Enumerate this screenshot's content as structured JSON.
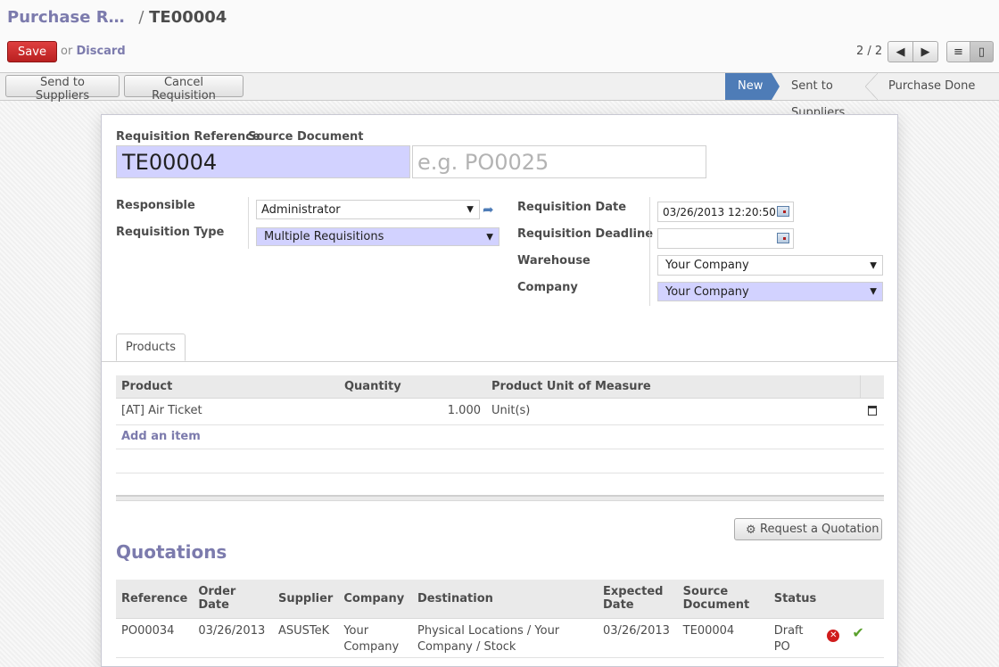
{
  "header": {
    "breadcrumb_parent": "Purchase R…",
    "breadcrumb_separator": "/",
    "breadcrumb_current": "TE00004",
    "save_label": "Save",
    "or_label": "or",
    "discard_label": "Discard",
    "pager_value": "2 / 2"
  },
  "statusbar": {
    "buttons": [
      "Send to Suppliers",
      "Cancel Requisition"
    ],
    "stages": [
      "New",
      "Sent to Suppliers",
      "Purchase Done"
    ],
    "active_stage": "New"
  },
  "form": {
    "requisition_reference_label": "Requisition Reference",
    "requisition_reference_value": "TE00004",
    "source_document_label": "Source Document",
    "source_document_placeholder": "e.g. PO0025",
    "responsible_label": "Responsible",
    "responsible_value": "Administrator",
    "requisition_type_label": "Requisition Type",
    "requisition_type_value": "Multiple Requisitions",
    "requisition_date_label": "Requisition Date",
    "requisition_date_value": "03/26/2013 12:20:50",
    "requisition_deadline_label": "Requisition Deadline",
    "requisition_deadline_value": "",
    "warehouse_label": "Warehouse",
    "warehouse_value": "Your Company",
    "company_label": "Company",
    "company_value": "Your Company"
  },
  "tabs": [
    "Products"
  ],
  "products": {
    "columns": [
      "Product",
      "Quantity",
      "Product Unit of Measure"
    ],
    "rows": [
      {
        "product": "[AT] Air Ticket",
        "quantity": "1.000",
        "uom": "Unit(s)"
      }
    ],
    "add_item_label": "Add an item"
  },
  "request_quotation_label": "Request a Quotation",
  "quotations": {
    "title": "Quotations",
    "columns": [
      "Reference",
      "Order Date",
      "Supplier",
      "Company",
      "Destination",
      "Expected Date",
      "Source Document",
      "Status"
    ],
    "rows": [
      {
        "reference": "PO00034",
        "order_date": "03/26/2013",
        "supplier": "ASUSTeK",
        "company": "Your Company",
        "destination": "Physical Locations / Your Company / Stock",
        "expected_date": "03/26/2013",
        "source_document": "TE00004",
        "status": "Draft PO"
      }
    ]
  },
  "colors": {
    "accent": "#7c7bad",
    "save_button": "#c42a2a",
    "active_stage": "#4e7cb7",
    "required_field": "#d2d2ff"
  },
  "icons": [
    "arrow-left-icon",
    "arrow-right-icon",
    "list-view-icon",
    "form-view-icon",
    "external-link-icon",
    "calendar-icon",
    "trash-icon",
    "gears-icon",
    "cancel-circle-icon",
    "checkmark-icon"
  ]
}
